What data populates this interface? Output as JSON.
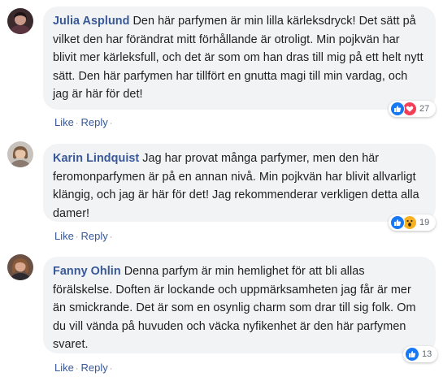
{
  "colors": {
    "link": "#385898",
    "bubble_bg": "#f2f3f5",
    "like_blue": "#1877f2",
    "love_red": "#f33e58",
    "wow_yellow": "#f7b125"
  },
  "comments": [
    {
      "author": "Julia Asplund",
      "text": "Den här parfymen är min lilla kärleksdryck! Det sätt på vilket den har förändrat mitt förhållande är otroligt. Min pojkvän har blivit mer kärleksfull, och det är som om han dras till mig på ett helt nytt sätt. Den här parfymen har tillfört en gnutta magi till min vardag, och jag är här för det!",
      "reactions": [
        "like-icon",
        "love-icon"
      ],
      "reaction_count": "27",
      "like_label": "Like",
      "reply_label": "Reply"
    },
    {
      "author": "Karin Lindquist",
      "text": "Jag har provat många parfymer, men den här feromonparfymen är på en annan nivå. Min pojkvän har blivit allvarligt klängig, och jag är här för det! Jag rekommenderar verkligen detta alla damer!",
      "reactions": [
        "like-icon",
        "wow-icon"
      ],
      "reaction_count": "19",
      "like_label": "Like",
      "reply_label": "Reply"
    },
    {
      "author": "Fanny Ohlin",
      "text": "Denna parfym är min hemlighet för att bli allas förälskelse. Doften är lockande och uppmärksamheten jag får är mer än smickrande. Det är som en osynlig charm som drar till sig folk. Om du vill vända på huvuden och väcka nyfikenhet är den här parfymen svaret.",
      "reactions": [
        "like-icon"
      ],
      "reaction_count": "13",
      "like_label": "Like",
      "reply_label": "Reply"
    }
  ]
}
